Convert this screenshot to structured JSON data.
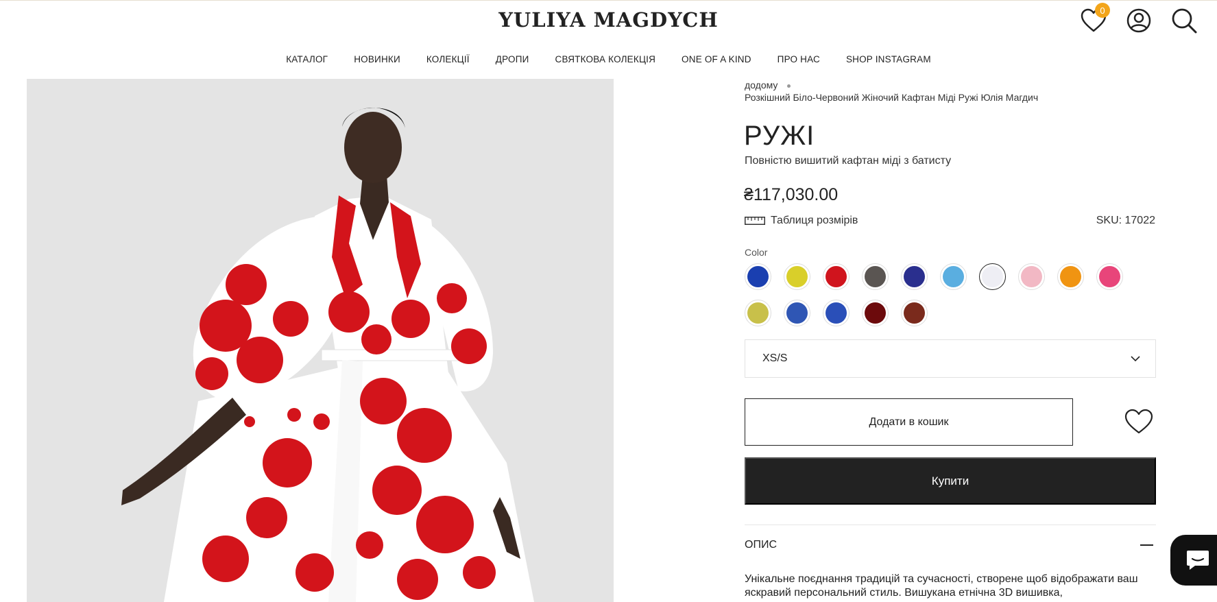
{
  "header": {
    "logo": "YULIYA MAGDYCH",
    "wishlist_count": "0"
  },
  "nav": {
    "items": [
      "КАТАЛОГ",
      "НОВИНКИ",
      "КОЛЕКЦІЇ",
      "ДРОПИ",
      "СВЯТКОВА КОЛЕКЦІЯ",
      "ONE OF A KIND",
      "ПРО НАС",
      "SHOP INSTAGRAM"
    ]
  },
  "breadcrumb": {
    "home": "додому",
    "current": "Розкішний Біло-Червоний Жіночий Кафтан Міді Ружі Юлія Магдич"
  },
  "product": {
    "title": "РУЖІ",
    "subtitle": "Повністю вишитий кафтан міді з батисту",
    "price": "₴117,030.00",
    "size_chart_label": "Таблиця розмірів",
    "sku": "SKU: 17022",
    "color_label": "Color",
    "selected_size": "XS/S",
    "add_to_cart": "Додати в кошик",
    "buy_now": "Купити",
    "description_heading": "ОПИС",
    "description_text": "Унікальне поєднання традицій та сучасності, створене щоб відображати ваш яскравий персональний стиль. Вишукана етнічна 3D вишивка,"
  },
  "colors": {
    "primary_button": "#222222",
    "badge": "#f3a51a",
    "hero_background": "#e4e4e4"
  },
  "swatches": [
    {
      "name": "blue",
      "color": "#1a3fb0"
    },
    {
      "name": "yellow",
      "color": "#d9cf2a"
    },
    {
      "name": "red",
      "color": "#d0141d"
    },
    {
      "name": "grey-orange",
      "color": "#5a5552"
    },
    {
      "name": "navy-white",
      "color": "#2a2f8e"
    },
    {
      "name": "light-blue",
      "color": "#5aaee0"
    },
    {
      "name": "white-red",
      "color": "#eeeef4"
    },
    {
      "name": "pink-mint",
      "color": "#f2b8c4"
    },
    {
      "name": "orange",
      "color": "#f09412"
    },
    {
      "name": "pink-blue",
      "color": "#e8457a"
    },
    {
      "name": "olive-yellow",
      "color": "#c8c04a"
    },
    {
      "name": "blue-yellow-1",
      "color": "#2f56b4"
    },
    {
      "name": "blue-yellow-2",
      "color": "#2a4fb8"
    },
    {
      "name": "dark-red",
      "color": "#6c0a0c"
    },
    {
      "name": "brown-white",
      "color": "#7a2a1c"
    }
  ],
  "active_swatch_index": 6
}
